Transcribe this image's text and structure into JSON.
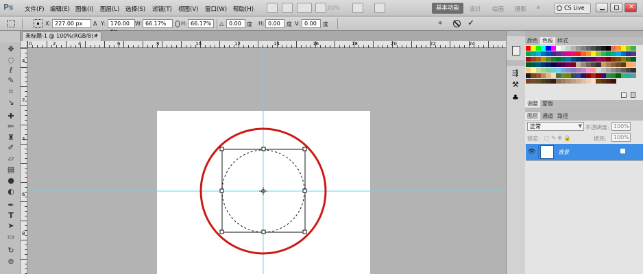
{
  "app": {
    "logo": "Ps"
  },
  "menu": [
    "文件(F)",
    "编辑(E)",
    "图像(I)",
    "图层(L)",
    "选择(S)",
    "滤镜(T)",
    "视图(V)",
    "窗口(W)",
    "帮助(H)"
  ],
  "menubar": {
    "zoom": "100%",
    "workspaces": [
      "基本功能",
      "设计",
      "绘画",
      "摄影"
    ],
    "more": "»",
    "cslive": "CS Live"
  },
  "options": {
    "x_label": "X:",
    "x_value": "227.00 px",
    "delta_label": "Δ",
    "y_label": "Y:",
    "y_value": "170.00 px",
    "w_label": "W:",
    "w_value": "66.17%",
    "h_label": "H:",
    "h_value": "66.17%",
    "angle_label": "△",
    "angle_value": "0.00",
    "angle_unit": "度",
    "hskew_label": "H:",
    "hskew_value": "0.00",
    "hskew_unit": "度",
    "vskew_label": "V:",
    "vskew_value": "0.00",
    "vskew_unit": "度"
  },
  "document": {
    "tab_title": "未标题-1 @ 100%(RGB/8) *",
    "close": "×"
  },
  "ruler_top": [
    "0",
    "2",
    "4",
    "6",
    "8",
    "10",
    "12",
    "14",
    "16",
    "18",
    "20",
    "22",
    "24"
  ],
  "ruler_left": [
    "4",
    "2",
    "4",
    "6",
    "8"
  ],
  "panels": {
    "color_tabs": [
      "颜色",
      "色板",
      "样式"
    ],
    "adjust_tabs": [
      "调整",
      "蒙版"
    ],
    "layer_tabs": [
      "图层",
      "通道",
      "路径"
    ],
    "blend_mode": "正常",
    "opacity_label": "不透明度:",
    "opacity_value": "100%",
    "lock_label": "锁定:",
    "fill_label": "填充:",
    "fill_value": "100%",
    "layer_name": "背景"
  },
  "colors": {
    "red_circle": "#cc1a10",
    "guide": "#5fd8ee",
    "layer_selected": "#3d8ee6"
  }
}
